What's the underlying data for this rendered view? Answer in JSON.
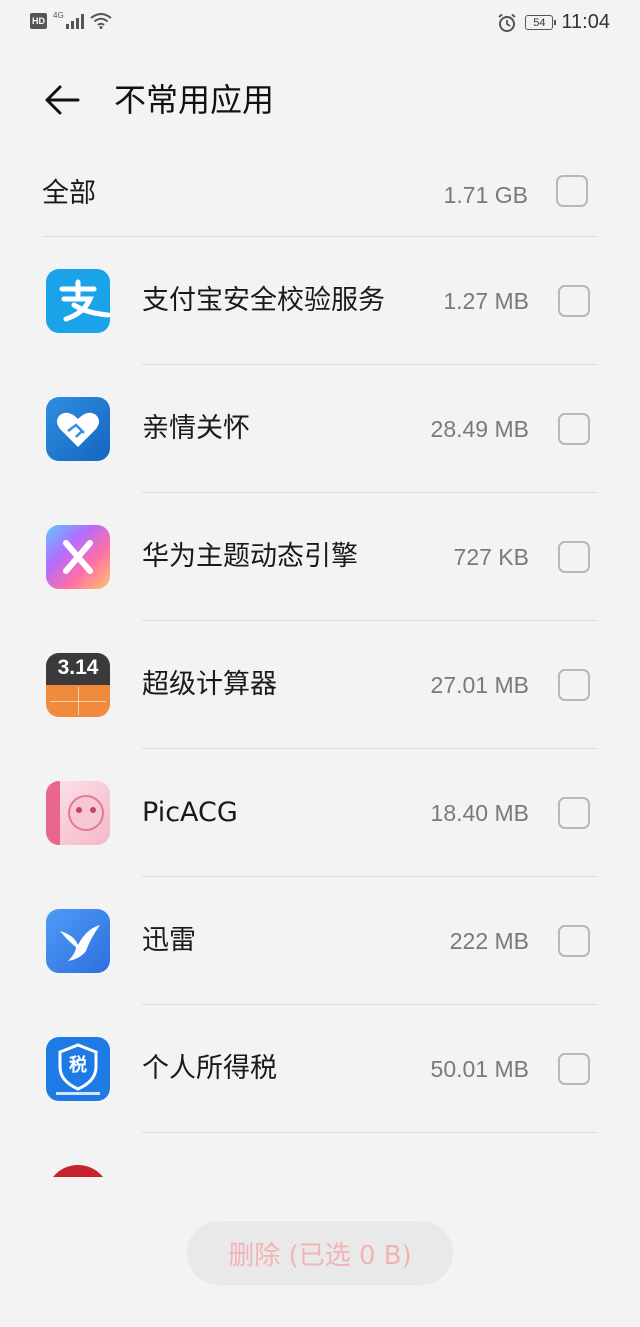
{
  "status_bar": {
    "hd": "HD",
    "network": "4G",
    "battery": "54",
    "time": "11:04"
  },
  "header": {
    "title": "不常用应用",
    "back_icon": "arrow-left-icon"
  },
  "all": {
    "label": "全部",
    "size": "1.71 GB",
    "checked": false
  },
  "apps": [
    {
      "name": "支付宝安全校验服务",
      "size": "1.27 MB",
      "icon": "alipay-icon",
      "checked": false
    },
    {
      "name": "亲情关怀",
      "size": "28.49 MB",
      "icon": "heart-handshake-icon",
      "checked": false
    },
    {
      "name": "华为主题动态引擎",
      "size": "727 KB",
      "icon": "theme-engine-icon",
      "checked": false
    },
    {
      "name": "超级计算器",
      "size": "27.01 MB",
      "icon": "calculator-icon",
      "checked": false
    },
    {
      "name": "PicACG",
      "size": "18.40 MB",
      "icon": "picacg-icon",
      "checked": false
    },
    {
      "name": "迅雷",
      "size": "222 MB",
      "icon": "xunlei-bird-icon",
      "checked": false
    },
    {
      "name": "个人所得税",
      "size": "50.01 MB",
      "icon": "tax-shield-icon",
      "checked": false
    }
  ],
  "calculator_icon_text": "3.14",
  "tax_icon_text": "税",
  "footer": {
    "delete_label": "删除 (已选 0 B)"
  },
  "colors": {
    "background": "#f3f3f3",
    "delete_text_disabled": "#f2b3b6",
    "checkbox_border": "#b8b8b8"
  }
}
